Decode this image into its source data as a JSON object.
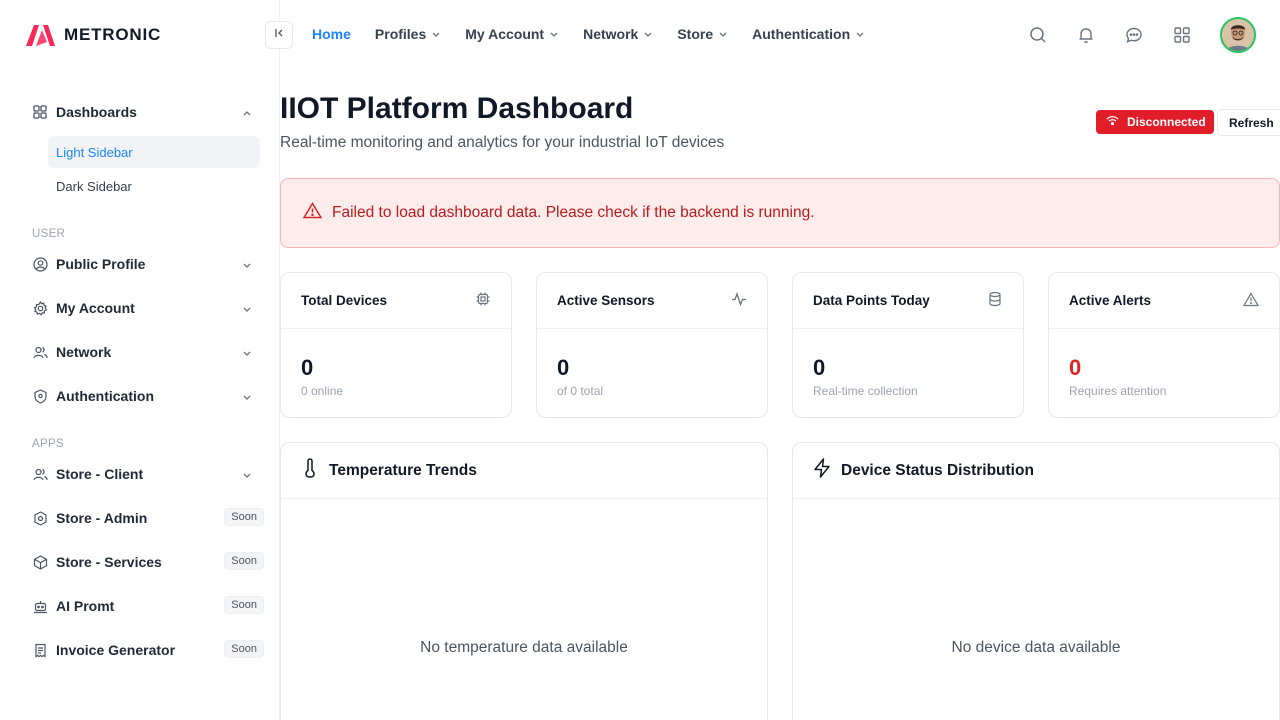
{
  "brand": {
    "name": "METRONIC"
  },
  "sidebar": {
    "dashboards_label": "Dashboards",
    "sub_items": [
      {
        "label": "Light Sidebar",
        "active": true
      },
      {
        "label": "Dark Sidebar",
        "active": false
      }
    ],
    "section_user": "USER",
    "user_items": [
      {
        "label": "Public Profile",
        "icon": "user-circle-icon"
      },
      {
        "label": "My Account",
        "icon": "gear-icon"
      },
      {
        "label": "Network",
        "icon": "users-icon"
      },
      {
        "label": "Authentication",
        "icon": "shield-icon"
      }
    ],
    "section_apps": "APPS",
    "app_items": [
      {
        "label": "Store - Client",
        "badge": ""
      },
      {
        "label": "Store - Admin",
        "badge": "Soon"
      },
      {
        "label": "Store - Services",
        "badge": "Soon"
      },
      {
        "label": "AI Promt",
        "badge": "Soon"
      },
      {
        "label": "Invoice Generator",
        "badge": "Soon"
      }
    ]
  },
  "topnav": {
    "items": [
      {
        "label": "Home",
        "active": true
      },
      {
        "label": "Profiles"
      },
      {
        "label": "My Account"
      },
      {
        "label": "Network"
      },
      {
        "label": "Store"
      },
      {
        "label": "Authentication"
      }
    ]
  },
  "page": {
    "title": "IIOT Platform Dashboard",
    "subtitle": "Real-time monitoring and analytics for your industrial IoT devices",
    "status_label": "Disconnected",
    "refresh_label": "Refresh",
    "alert": "Failed to load dashboard data. Please check if the backend is running."
  },
  "stats": [
    {
      "title": "Total Devices",
      "value": "0",
      "sub": "0 online",
      "icon": "chip-icon"
    },
    {
      "title": "Active Sensors",
      "value": "0",
      "sub": "of 0 total",
      "icon": "activity-icon"
    },
    {
      "title": "Data Points Today",
      "value": "0",
      "sub": "Real-time collection",
      "icon": "database-icon"
    },
    {
      "title": "Active Alerts",
      "value": "0",
      "sub": "Requires attention",
      "icon": "warning-icon"
    }
  ],
  "panels": [
    {
      "title": "Temperature Trends",
      "empty": "No temperature data available",
      "icon": "thermometer-icon"
    },
    {
      "title": "Device Status Distribution",
      "empty": "No device data available",
      "icon": "lightning-icon"
    }
  ],
  "colors": {
    "accent": "#1b84ff",
    "danger": "#e11d2a",
    "brand": "#f8285a"
  }
}
